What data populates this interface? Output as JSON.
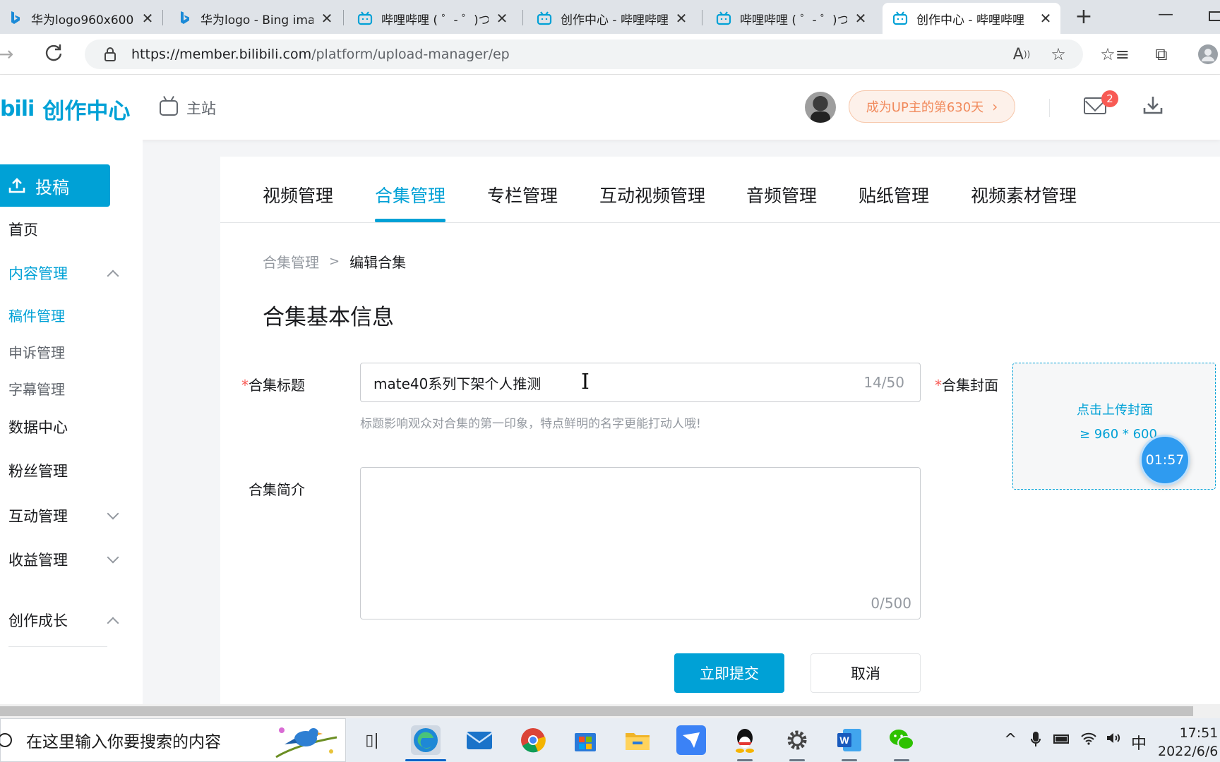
{
  "browser": {
    "tabs": [
      {
        "title": "华为logo960x600 -",
        "icon": "bing-icon"
      },
      {
        "title": "华为logo - Bing ima",
        "icon": "bing-icon"
      },
      {
        "title": "哔哩哔哩 ( ゜- ゜)つロ",
        "icon": "bilibili-icon"
      },
      {
        "title": "创作中心 - 哔哩哔哩",
        "icon": "bilibili-icon"
      },
      {
        "title": "哔哩哔哩 ( ゜- ゜)つロ",
        "icon": "bilibili-icon"
      },
      {
        "title": "创作中心 - 哔哩哔哩",
        "icon": "bilibili-icon",
        "active": true
      }
    ],
    "url_host": "https://member.bilibili.com",
    "url_path": "/platform/upload-manager/ep"
  },
  "header": {
    "logo_mark": "bili",
    "logo_text": "创作中心",
    "main_site": "主站",
    "up_days": "成为UP主的第630天",
    "mail_badge": "2"
  },
  "sidebar": {
    "upload_label": "投稿",
    "items": [
      {
        "label": "首页"
      },
      {
        "label": "内容管理"
      },
      {
        "label": "稿件管理"
      },
      {
        "label": "申诉管理"
      },
      {
        "label": "字幕管理"
      },
      {
        "label": "数据中心"
      },
      {
        "label": "粉丝管理"
      },
      {
        "label": "互动管理"
      },
      {
        "label": "收益管理"
      },
      {
        "label": "创作成长"
      }
    ]
  },
  "main": {
    "tabs": [
      {
        "label": "视频管理"
      },
      {
        "label": "合集管理"
      },
      {
        "label": "专栏管理"
      },
      {
        "label": "互动视频管理"
      },
      {
        "label": "音频管理"
      },
      {
        "label": "贴纸管理"
      },
      {
        "label": "视频素材管理"
      }
    ],
    "breadcrumb": {
      "parent": "合集管理",
      "separator": ">",
      "current": "编辑合集"
    },
    "section_title": "合集基本信息",
    "form": {
      "title_label": "合集标题",
      "title_value": "mate40系列下架个人推测",
      "title_count": "14/50",
      "title_hint": "标题影响观众对合集的第一印象，特点鲜明的名字更能打动人哦!",
      "desc_label": "合集简介",
      "desc_count": "0/500",
      "cover_label": "合集封面",
      "cover_upload": "点击上传封面",
      "cover_size": "≥ 960 * 600",
      "required_mark": "*"
    },
    "timer": "01:57",
    "submit_label": "立即提交",
    "cancel_label": "取消"
  },
  "taskbar": {
    "search_placeholder": "在这里输入你要搜索的内容",
    "ime": "中",
    "time": "17:51",
    "date": "2022/6/6"
  },
  "colors": {
    "accent": "#00a1d6",
    "up_badge_text": "#f18a5c",
    "required": "#f85a54"
  }
}
